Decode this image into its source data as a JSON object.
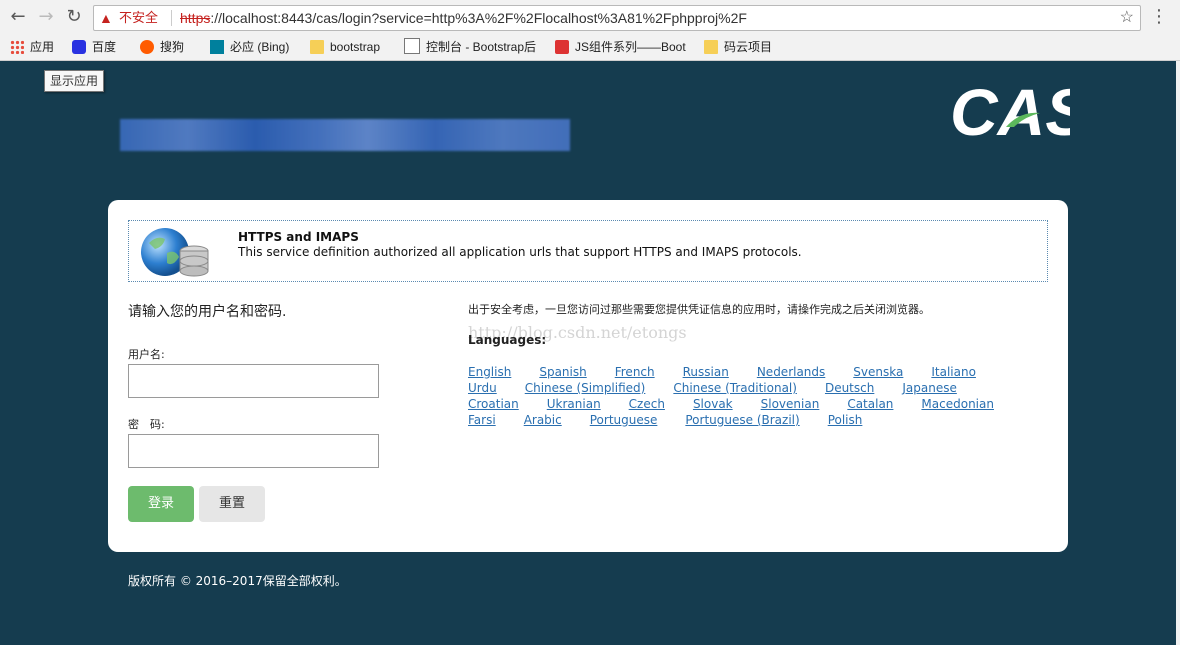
{
  "browser": {
    "security_warning": "不安全",
    "url_scheme": "https",
    "url_rest": "://localhost:8443/cas/login?service=http%3A%2F%2Flocalhost%3A81%2Fphpproj%2F",
    "bookmarks": [
      {
        "label": "应用",
        "icon": "apps-icon"
      },
      {
        "label": "百度",
        "icon": "baidu-icon"
      },
      {
        "label": "搜狗",
        "icon": "sogou-icon"
      },
      {
        "label": "必应 (Bing)",
        "icon": "bing-icon"
      },
      {
        "label": "bootstrap",
        "icon": "folder-icon"
      },
      {
        "label": "控制台 - Bootstrap后",
        "icon": "page-icon"
      },
      {
        "label": "JS组件系列——Boot",
        "icon": "js-icon"
      },
      {
        "label": "码云项目",
        "icon": "folder-icon"
      }
    ],
    "tooltip": "显示应用"
  },
  "page": {
    "logo_text": "CAS",
    "notice": {
      "title": "HTTPS and IMAPS",
      "description": "This service definition authorized all application urls that support HTTPS and IMAPS protocols."
    },
    "login": {
      "heading": "请输入您的用户名和密码.",
      "username_label": "用户名:",
      "password_label": "密　码:",
      "username_value": "",
      "password_value": "",
      "login_button": "登录",
      "reset_button": "重置"
    },
    "security_note": "出于安全考虑，一旦您访问过那些需要您提供凭证信息的应用时，请操作完成之后关闭浏览器。",
    "watermark": "http://blog.csdn.net/etongs",
    "languages_title": "Languages:",
    "languages": [
      [
        "English",
        "Spanish",
        "French",
        "Russian",
        "Nederlands",
        "Svenska",
        "Italiano"
      ],
      [
        "Urdu",
        "Chinese (Simplified)",
        "Chinese (Traditional)",
        "Deutsch",
        "Japanese"
      ],
      [
        "Croatian",
        "Ukranian",
        "Czech",
        "Slovak",
        "Slovenian",
        "Catalan",
        "Macedonian"
      ],
      [
        "Farsi",
        "Arabic",
        "Portuguese",
        "Portuguese (Brazil)",
        "Polish"
      ]
    ],
    "footer": "版权所有 © 2016–2017保留全部权利。"
  },
  "colors": {
    "page_background": "#153c4f",
    "link": "#2a6fb0",
    "login_button": "#6dbb6d",
    "warning": "#c5221f"
  }
}
